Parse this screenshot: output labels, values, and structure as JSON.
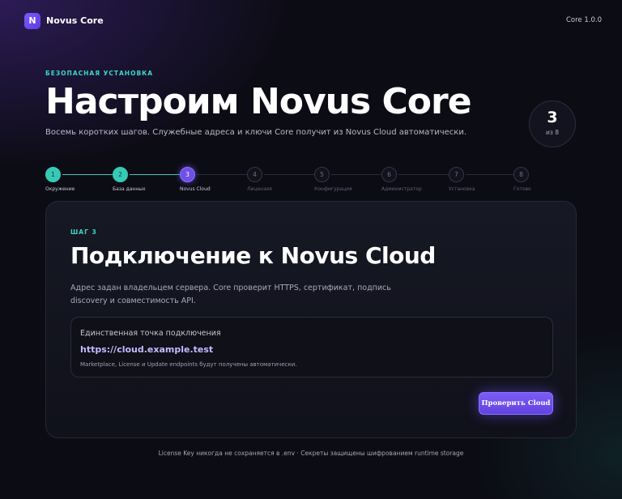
{
  "app": {
    "logo_letter": "N",
    "name": "Novus Core",
    "version": "Core 1.0.0"
  },
  "hero": {
    "eyebrow": "БЕЗОПАСНАЯ УСТАНОВКА",
    "title": "Настроим Novus Core",
    "subtitle": "Восемь коротких шагов. Служебные адреса и ключи Core получит из Novus Cloud автоматически."
  },
  "step_counter": {
    "current": "3",
    "of": "из 8"
  },
  "stepper": {
    "steps": [
      {
        "num": "1",
        "label": "Окружение",
        "state": "done"
      },
      {
        "num": "2",
        "label": "База данных",
        "state": "done"
      },
      {
        "num": "3",
        "label": "Novus Cloud",
        "state": "active"
      },
      {
        "num": "4",
        "label": "Лицензия",
        "state": "pending"
      },
      {
        "num": "5",
        "label": "Конфигурация",
        "state": "pending"
      },
      {
        "num": "6",
        "label": "Администратор",
        "state": "pending"
      },
      {
        "num": "7",
        "label": "Установка",
        "state": "pending"
      },
      {
        "num": "8",
        "label": "Готово",
        "state": "pending"
      }
    ]
  },
  "card": {
    "kicker": "ШАГ 3",
    "heading": "Подключение к Novus Cloud",
    "description": "Адрес задан владельцем сервера. Core проверит HTTPS, сертификат, подпись discovery и совместимость API.",
    "endpoint": {
      "label": "Единственная точка подключения",
      "url": "https://cloud.example.test",
      "note": "Marketplace, License и Update endpoints будут получены автоматически."
    },
    "button": "Проверить Cloud"
  },
  "footer": "License Key никогда не сохраняется в .env · Секреты защищены шифрованием runtime storage",
  "colors": {
    "accent": "#6f4fe8",
    "success": "#36c9b6",
    "eyebrow": "#3dd6c6",
    "link": "#c6b8ff"
  }
}
